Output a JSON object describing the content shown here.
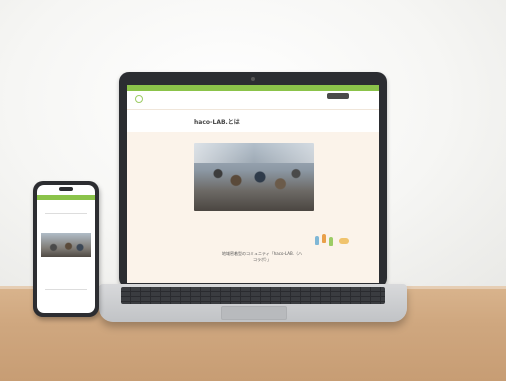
{
  "laptop_site": {
    "topbar_text": "",
    "logo_text": "",
    "logo_subtext": "",
    "phone": "",
    "contact_button": "",
    "nav": [],
    "page_title": "haco-LAB.とは",
    "headline": "地域密着型のコミュニティ「haco-LAB.（ハコラボ）」",
    "subline": ""
  },
  "phone_site": {
    "logo_text": "",
    "page_title": "",
    "body_text": ""
  },
  "colors": {
    "accent_green": "#8bc34a",
    "page_bg": "#fbf3ea"
  }
}
